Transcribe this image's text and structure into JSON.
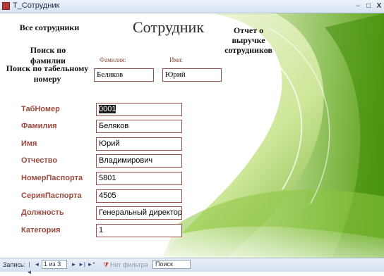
{
  "window": {
    "title": "Т_Сотрудник",
    "min": "‒",
    "max": "□",
    "close": "X"
  },
  "form": {
    "heading": "Сотрудник",
    "links": {
      "all_employees": "Все сотрудники",
      "search_lastname": "Поиск по фамилии",
      "search_tabnum": "Поиск по табельному номеру",
      "revenue_report": "Отчет о выручке сотрудников"
    },
    "search": {
      "lastname_label": "Фамилия:",
      "firstname_label": "Имя:",
      "lastname_value": "Беляков",
      "firstname_value": "Юрий"
    },
    "fields": [
      {
        "label": "ТабНомер",
        "value": "0001"
      },
      {
        "label": "Фамилия",
        "value": "Беляков"
      },
      {
        "label": "Имя",
        "value": "Юрий"
      },
      {
        "label": "Отчество",
        "value": "Владимирович"
      },
      {
        "label": "НомерПаспорта",
        "value": "5801"
      },
      {
        "label": "СерияПаспорта",
        "value": "4505"
      },
      {
        "label": "Должность",
        "value": "Генеральный директор"
      },
      {
        "label": "Категория",
        "value": "1"
      }
    ]
  },
  "navbar": {
    "records_label": "Запись:",
    "first": "|◄",
    "prev": "◄",
    "record_position": "1 из 3",
    "next": "►",
    "last": "►|",
    "new": "►*",
    "filter_icon": "funnel-icon",
    "filter_label": "Нет фильтра",
    "search_label": "Поиск"
  },
  "colors": {
    "label": "#9c4a3e",
    "field_border": "#a0524a",
    "accent_green": "#7fbf1f"
  }
}
